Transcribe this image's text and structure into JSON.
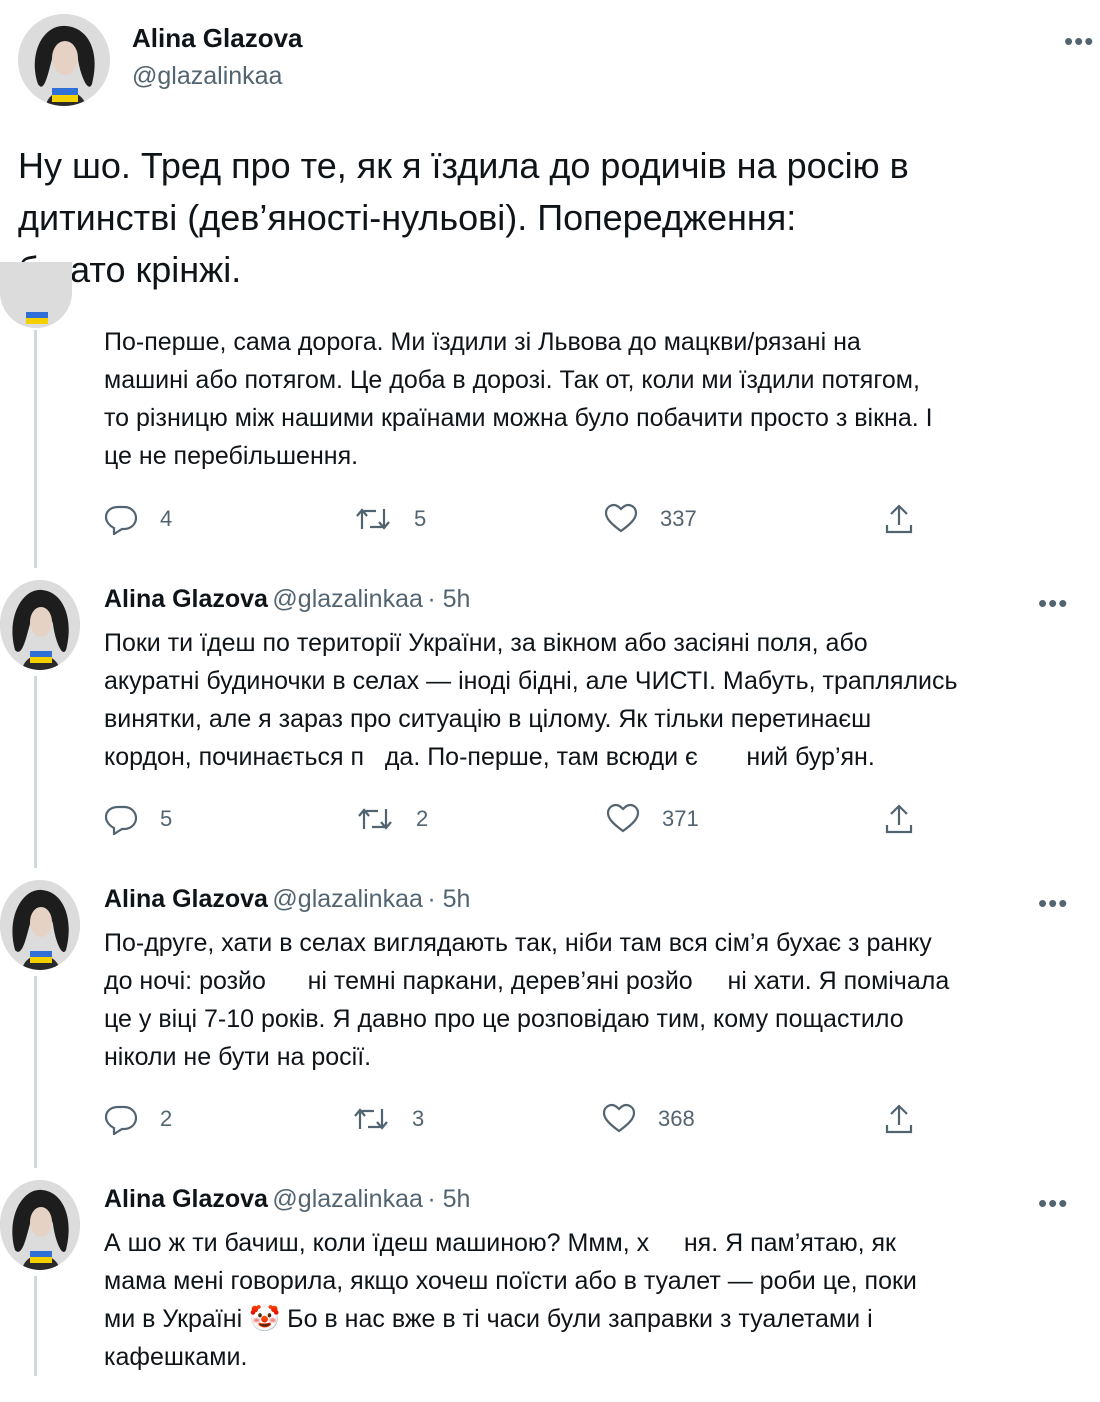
{
  "main": {
    "name": "Alina Glazova",
    "handle": "@glazalinkaa",
    "text": "Ну шо. Тред про те, як я їздила до родичів на росію в\nдитинстві (дев’яності-нульові). Попередження:\nбагато крінжі."
  },
  "replies": [
    {
      "text": "По-перше, сама дорога. Ми їздили зі Львова до мацкви/рязані на\nмашині або потягом. Це доба в дорозі. Так от, коли ми їздили потягом,\nто різницю між нашими країнами можна було побачити просто з вікна. І\nце не перебільшення.",
      "replies": "4",
      "retweets": "5",
      "likes": "337"
    },
    {
      "name": "Alina Glazova",
      "handle": "@glazalinkaa",
      "time": "· 5h",
      "text": "Поки ти їдеш по території України, за вікном або засіяні поля, або\nакуратні будиночки в селах — іноді бідні, але ЧИСТІ. Мабуть, траплялись\nвинятки, але я зараз про ситуацію в цілому. Як тільки перетинаєш\nкордон, починається п   да. По-перше, там всюди є       ний бур’ян.",
      "replies": "5",
      "retweets": "2",
      "likes": "371"
    },
    {
      "name": "Alina Glazova",
      "handle": "@glazalinkaa",
      "time": "· 5h",
      "text": "По-друге, хати в селах виглядають так, ніби там вся сім’я бухає з ранку\nдо ночі: розйо      ні темні паркани, дерев’яні розйо     ні хати. Я помічала\nце у віці 7-10 років. Я давно про це розповідаю тим, кому пощастило\nніколи не бути на росії.",
      "replies": "2",
      "retweets": "3",
      "likes": "368"
    },
    {
      "name": "Alina Glazova",
      "handle": "@glazalinkaa",
      "time": "· 5h",
      "text_a": "А шо ж ти бачиш, коли їдеш машиною? Ммм, х     ня. Я пам’ятаю, як\nмама мені говорила, якщо хочеш поїсти або в туалет — роби це, поки\nми в Україні ",
      "emoji": "🤡",
      "text_b": " Бо в нас вже в ті часи були заправки з туалетами і\nкафешками."
    }
  ],
  "more_label": "•••"
}
